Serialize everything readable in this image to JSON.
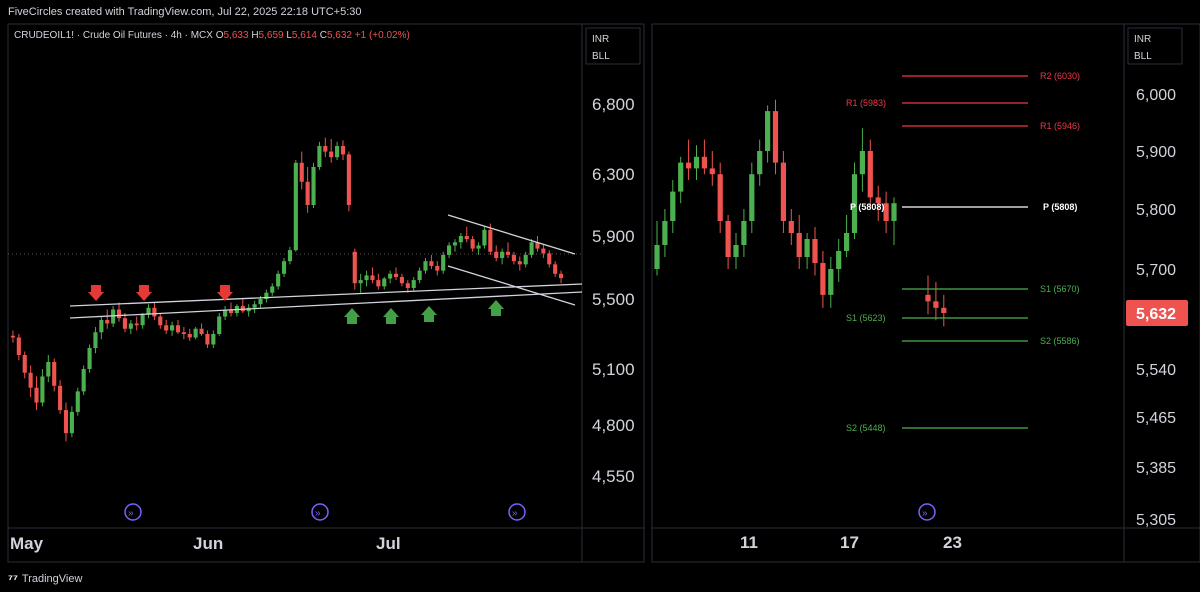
{
  "header": {
    "created_text": "FiveCircles created with TradingView.com, Jul 22, 2025 22:18 UTC+5:30"
  },
  "footer": {
    "brand": "TradingView"
  },
  "left_chart": {
    "symbol_line": "CRUDEOIL1! · Crude Oil Futures · 4h · MCX",
    "ohlc": {
      "o_label": "O",
      "o": "5,633",
      "h_label": "H",
      "h": "5,659",
      "l_label": "L",
      "l": "5,614",
      "c_label": "C",
      "c": "5,632",
      "chg": "+1 (+0.02%)"
    },
    "currency": "INR",
    "unit": "BLL"
  },
  "right_chart": {
    "currency": "INR",
    "unit": "BLL",
    "last_price": "5,632"
  },
  "colors": {
    "up": "#26a69a",
    "up_bright": "#4caf50",
    "down": "#ef5350",
    "bg": "#000000",
    "resistance": "#f23645",
    "support": "#4caf50",
    "pivot": "#ffffff",
    "trend": "#d1d4dc"
  },
  "icons": {
    "arrow_up": "green-up-arrow-icon",
    "arrow_down": "red-down-arrow-icon",
    "event": "event-marker-icon"
  },
  "chart_data": [
    {
      "type": "candlestick",
      "title": "",
      "y_ticks": [
        "6,800",
        "6,300",
        "5,900",
        "5,500",
        "5,100",
        "4,800",
        "4,550"
      ],
      "x_ticks": [
        "May",
        "Jun",
        "Jul"
      ],
      "ylim": [
        4350,
        7000
      ],
      "series": [
        {
          "values": [
            [
              5290,
              5320,
              5250,
              5280
            ],
            [
              5280,
              5300,
              5150,
              5180
            ],
            [
              5180,
              5200,
              5050,
              5080
            ],
            [
              5080,
              5120,
              4950,
              5000
            ],
            [
              5000,
              5060,
              4880,
              4920
            ],
            [
              4920,
              5100,
              4900,
              5060
            ],
            [
              5060,
              5180,
              5030,
              5140
            ],
            [
              5140,
              5160,
              4980,
              5010
            ],
            [
              5010,
              5040,
              4860,
              4880
            ],
            [
              4880,
              4920,
              4720,
              4760
            ],
            [
              4760,
              4900,
              4740,
              4870
            ],
            [
              4870,
              5000,
              4850,
              4980
            ],
            [
              4980,
              5120,
              4960,
              5100
            ],
            [
              5100,
              5240,
              5080,
              5220
            ],
            [
              5220,
              5340,
              5190,
              5310
            ],
            [
              5310,
              5400,
              5270,
              5380
            ],
            [
              5380,
              5440,
              5330,
              5360
            ],
            [
              5360,
              5460,
              5340,
              5440
            ],
            [
              5440,
              5480,
              5370,
              5390
            ],
            [
              5390,
              5420,
              5310,
              5330
            ],
            [
              5330,
              5380,
              5300,
              5360
            ],
            [
              5360,
              5400,
              5320,
              5350
            ],
            [
              5350,
              5420,
              5330,
              5410
            ],
            [
              5410,
              5470,
              5390,
              5450
            ],
            [
              5450,
              5480,
              5380,
              5400
            ],
            [
              5400,
              5420,
              5330,
              5350
            ],
            [
              5350,
              5380,
              5300,
              5320
            ],
            [
              5320,
              5370,
              5290,
              5350
            ],
            [
              5350,
              5380,
              5300,
              5310
            ],
            [
              5310,
              5340,
              5270,
              5300
            ],
            [
              5300,
              5330,
              5260,
              5280
            ],
            [
              5280,
              5340,
              5270,
              5330
            ],
            [
              5330,
              5360,
              5290,
              5300
            ],
            [
              5300,
              5320,
              5220,
              5240
            ],
            [
              5240,
              5320,
              5220,
              5300
            ],
            [
              5300,
              5420,
              5290,
              5400
            ],
            [
              5400,
              5460,
              5380,
              5440
            ],
            [
              5440,
              5480,
              5400,
              5420
            ],
            [
              5420,
              5470,
              5400,
              5460
            ],
            [
              5460,
              5500,
              5420,
              5430
            ],
            [
              5430,
              5470,
              5400,
              5450
            ],
            [
              5450,
              5490,
              5420,
              5470
            ],
            [
              5470,
              5520,
              5450,
              5500
            ],
            [
              5500,
              5560,
              5480,
              5540
            ],
            [
              5540,
              5600,
              5520,
              5580
            ],
            [
              5580,
              5680,
              5560,
              5660
            ],
            [
              5660,
              5760,
              5640,
              5740
            ],
            [
              5740,
              5830,
              5720,
              5810
            ],
            [
              5810,
              6400,
              5800,
              6380
            ],
            [
              6380,
              6460,
              6200,
              6250
            ],
            [
              6250,
              6350,
              6050,
              6100
            ],
            [
              6100,
              6380,
              6080,
              6350
            ],
            [
              6350,
              6530,
              6330,
              6500
            ],
            [
              6500,
              6560,
              6420,
              6460
            ],
            [
              6460,
              6550,
              6380,
              6420
            ],
            [
              6420,
              6530,
              6400,
              6500
            ],
            [
              6500,
              6540,
              6400,
              6440
            ],
            [
              6440,
              6460,
              6060,
              6100
            ],
            [
              5800,
              5820,
              5560,
              5600
            ],
            [
              5600,
              5660,
              5540,
              5620
            ],
            [
              5620,
              5680,
              5580,
              5650
            ],
            [
              5650,
              5700,
              5600,
              5620
            ],
            [
              5620,
              5660,
              5560,
              5580
            ],
            [
              5580,
              5640,
              5560,
              5630
            ],
            [
              5630,
              5680,
              5600,
              5660
            ],
            [
              5660,
              5700,
              5620,
              5640
            ],
            [
              5640,
              5660,
              5580,
              5600
            ],
            [
              5600,
              5620,
              5540,
              5570
            ],
            [
              5570,
              5640,
              5550,
              5620
            ],
            [
              5620,
              5700,
              5600,
              5680
            ],
            [
              5680,
              5760,
              5660,
              5740
            ],
            [
              5740,
              5780,
              5690,
              5710
            ],
            [
              5710,
              5740,
              5650,
              5680
            ],
            [
              5680,
              5800,
              5660,
              5780
            ],
            [
              5780,
              5860,
              5760,
              5840
            ],
            [
              5840,
              5880,
              5800,
              5860
            ],
            [
              5860,
              5920,
              5820,
              5900
            ],
            [
              5900,
              5960,
              5860,
              5880
            ],
            [
              5880,
              5900,
              5800,
              5820
            ],
            [
              5820,
              5860,
              5780,
              5840
            ],
            [
              5840,
              5960,
              5820,
              5940
            ],
            [
              5940,
              5980,
              5780,
              5800
            ],
            [
              5800,
              5840,
              5740,
              5760
            ],
            [
              5760,
              5820,
              5720,
              5800
            ],
            [
              5800,
              5860,
              5760,
              5780
            ],
            [
              5780,
              5800,
              5720,
              5740
            ],
            [
              5740,
              5770,
              5680,
              5720
            ],
            [
              5720,
              5800,
              5700,
              5780
            ],
            [
              5780,
              5880,
              5760,
              5860
            ],
            [
              5860,
              5900,
              5800,
              5820
            ],
            [
              5820,
              5850,
              5760,
              5790
            ],
            [
              5790,
              5810,
              5700,
              5720
            ],
            [
              5720,
              5740,
              5640,
              5660
            ],
            [
              5660,
              5680,
              5600,
              5633
            ]
          ]
        }
      ],
      "annotations": {
        "up_arrows": 4,
        "down_arrows": 3
      }
    },
    {
      "type": "candlestick",
      "title": "",
      "y_ticks": [
        "6,000",
        "5,900",
        "5,800",
        "5,700",
        "5,632",
        "5,540",
        "5,465",
        "5,385",
        "5,305"
      ],
      "x_ticks": [
        "11",
        "17",
        "23"
      ],
      "ylim": [
        5300,
        6060
      ],
      "series": [
        {
          "values": [
            [
              5700,
              5780,
              5690,
              5740
            ],
            [
              5740,
              5800,
              5720,
              5780
            ],
            [
              5780,
              5850,
              5760,
              5830
            ],
            [
              5830,
              5890,
              5810,
              5880
            ],
            [
              5880,
              5920,
              5850,
              5870
            ],
            [
              5870,
              5910,
              5850,
              5890
            ],
            [
              5890,
              5920,
              5860,
              5870
            ],
            [
              5870,
              5900,
              5840,
              5860
            ],
            [
              5860,
              5880,
              5760,
              5780
            ],
            [
              5780,
              5790,
              5700,
              5720
            ],
            [
              5720,
              5760,
              5700,
              5740
            ],
            [
              5740,
              5800,
              5720,
              5780
            ],
            [
              5780,
              5880,
              5760,
              5860
            ],
            [
              5860,
              5920,
              5840,
              5900
            ],
            [
              5900,
              5980,
              5880,
              5970
            ],
            [
              5970,
              5990,
              5860,
              5880
            ],
            [
              5880,
              5900,
              5760,
              5780
            ],
            [
              5780,
              5800,
              5740,
              5760
            ],
            [
              5760,
              5790,
              5700,
              5720
            ],
            [
              5720,
              5760,
              5700,
              5750
            ],
            [
              5750,
              5770,
              5690,
              5710
            ],
            [
              5710,
              5730,
              5640,
              5660
            ],
            [
              5660,
              5720,
              5640,
              5700
            ],
            [
              5700,
              5750,
              5680,
              5730
            ],
            [
              5730,
              5790,
              5720,
              5760
            ],
            [
              5760,
              5880,
              5750,
              5860
            ],
            [
              5860,
              5940,
              5830,
              5900
            ],
            [
              5900,
              5920,
              5800,
              5820
            ],
            [
              5820,
              5840,
              5780,
              5810
            ],
            [
              5810,
              5830,
              5760,
              5780
            ],
            [
              5780,
              5820,
              5740,
              5810
            ],
            [
              5660,
              5690,
              5630,
              5650
            ],
            [
              5650,
              5680,
              5620,
              5640
            ],
            [
              5640,
              5660,
              5610,
              5632
            ]
          ]
        }
      ],
      "pivot_levels": [
        {
          "label": "R2 (6030)",
          "value": 6030
        },
        {
          "label": "R1 (5983)",
          "value": 5983
        },
        {
          "label": "R1 (5946)",
          "value": 5946
        },
        {
          "label": "P (5808)",
          "value": 5808
        },
        {
          "label": "P (5808)",
          "value": 5808
        },
        {
          "label": "S1 (5670)",
          "value": 5670
        },
        {
          "label": "S1 (5623)",
          "value": 5623
        },
        {
          "label": "S2 (5586)",
          "value": 5586
        },
        {
          "label": "S2 (5448)",
          "value": 5448
        }
      ]
    }
  ]
}
